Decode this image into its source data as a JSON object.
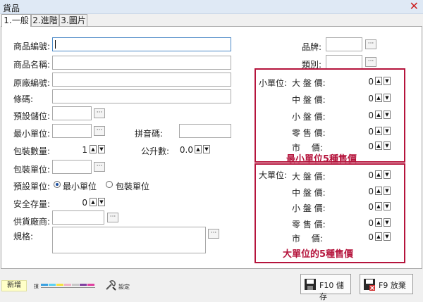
{
  "window": {
    "title": "貨品",
    "close_icon": "close-icon"
  },
  "tabs": [
    "1.一般",
    "2.進階",
    "3.圖片"
  ],
  "form": {
    "product_code_label": "商品編號:",
    "product_name_label": "商品名稱:",
    "factory_code_label": "原廠編號:",
    "barcode_label": "條碼:",
    "default_location_label": "預設儲位:",
    "min_unit_label": "最小單位:",
    "pinyin_label": "拼音碼:",
    "pack_qty_label": "包裝數量:",
    "pack_qty_value": "1",
    "liters_label": "公升數:",
    "liters_value": "0.0",
    "pack_unit_label": "包裝單位:",
    "default_unit_label": "預設單位:",
    "radio_min_unit": "最小單位",
    "radio_pack_unit": "包裝單位",
    "safety_stock_label": "安全存量:",
    "safety_stock_value": "0",
    "supplier_label": "供貨廠商:",
    "spec_label": "規格:",
    "brand_label": "品牌:",
    "category_label": "類別:"
  },
  "small_unit": {
    "header": "小單位:",
    "prices": [
      {
        "label": "大 盤 價:",
        "value": "0"
      },
      {
        "label": "中 盤 價:",
        "value": "0"
      },
      {
        "label": "小 盤 價:",
        "value": "0"
      },
      {
        "label": "零 售 價:",
        "value": "0"
      },
      {
        "label": "市 　價:",
        "value": "0"
      }
    ],
    "caption": "最小單位5種售價"
  },
  "big_unit": {
    "header": "大單位:",
    "prices": [
      {
        "label": "大 盤 價:",
        "value": "0"
      },
      {
        "label": "中 盤 價:",
        "value": "0"
      },
      {
        "label": "小 盤 價:",
        "value": "0"
      },
      {
        "label": "零 售 價:",
        "value": "0"
      },
      {
        "label": "市 　價:",
        "value": "0"
      }
    ],
    "caption": "大單位的5種售價"
  },
  "bottom": {
    "status": "新增",
    "palette_label": "摃",
    "settings_label": "設定",
    "save_button": "F10 儲存",
    "cancel_button": "F9 放棄"
  },
  "colors": {
    "accent_red": "#b5143c",
    "palette": [
      "#3aa0e0",
      "#5ad0f0",
      "#f5e040",
      "#f0b0c8",
      "#c8c8c8",
      "#8040a0",
      "#e040a0"
    ]
  }
}
